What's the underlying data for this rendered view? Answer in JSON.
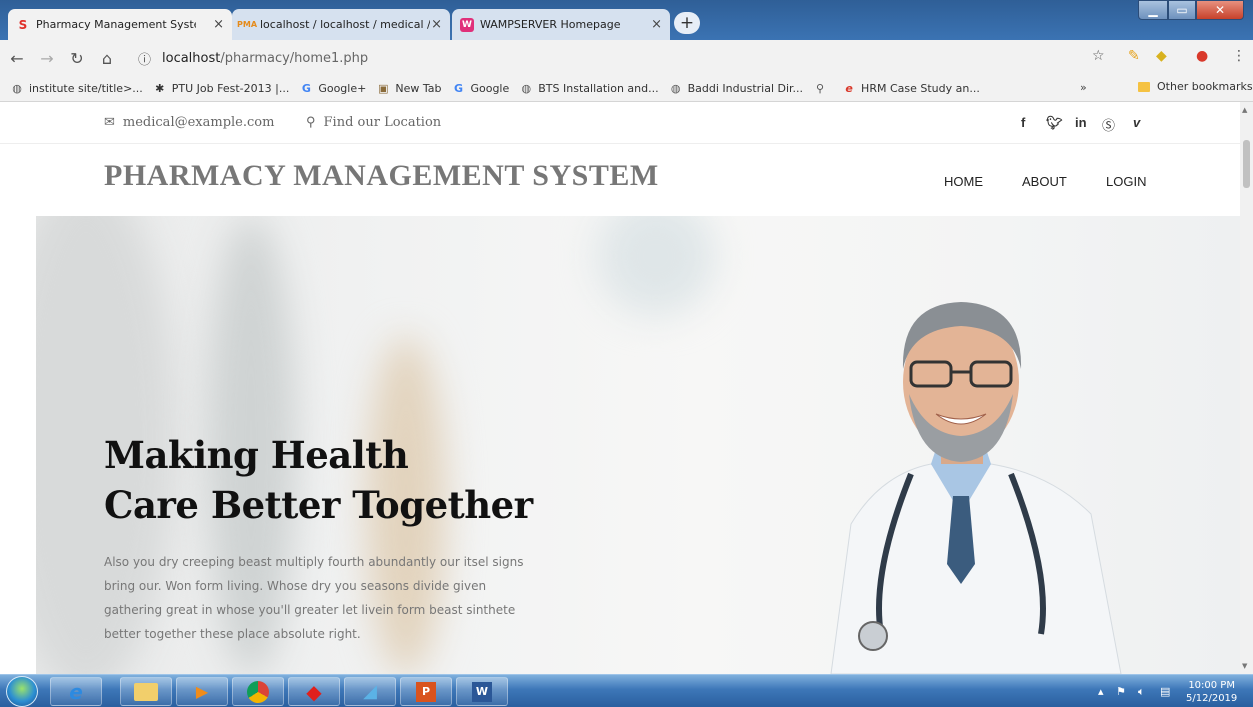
{
  "browser": {
    "tabs": [
      {
        "title": "Pharmacy Management System",
        "favicon": "S",
        "active": true
      },
      {
        "title": "localhost / localhost / medical / t",
        "favicon": "PMA",
        "active": false
      },
      {
        "title": "WAMPSERVER Homepage",
        "favicon": "W",
        "active": false
      }
    ],
    "close_glyph": "×",
    "new_tab_glyph": "+",
    "address": {
      "host": "localhost",
      "path": "/pharmacy/home1.php"
    },
    "bookmarks": [
      {
        "label": "institute site/title>...",
        "icon": "globe-icon"
      },
      {
        "label": "PTU Job Fest-2013 |...",
        "icon": "ptu-icon"
      },
      {
        "label": "Google+",
        "icon": "google-icon"
      },
      {
        "label": "New Tab",
        "icon": "newtab-icon"
      },
      {
        "label": "Google",
        "icon": "google-icon"
      },
      {
        "label": "BTS Installation and...",
        "icon": "globe-icon"
      },
      {
        "label": "Baddi Industrial Dir...",
        "icon": "globe-icon"
      },
      {
        "label": "HRM Case Study an...",
        "icon": "ie-icon"
      }
    ],
    "bookmarks_more": "»",
    "other_bookmarks": "Other bookmarks"
  },
  "site": {
    "email": "medical@example.com",
    "location": "Find our Location",
    "social": [
      "f",
      "t",
      "in",
      "s",
      "v"
    ],
    "brand": "PHARMACY MANAGEMENT SYSTEM",
    "nav": [
      "HOME",
      "ABOUT",
      "LOGIN"
    ],
    "hero": {
      "title_line1": "Making Health",
      "title_line2": "Care Better Together",
      "text": "Also you dry creeping beast multiply fourth abundantly our itsel signs bring our. Won form living. Whose dry you seasons divide given gathering great in whose you'll greater let livein form beast sinthete better together these place absolute right."
    }
  },
  "taskbar": {
    "time": "10:00 PM",
    "date": "5/12/2019",
    "apps": [
      "ie-icon",
      "explorer-icon",
      "media-player-icon",
      "chrome-icon",
      "app-red-icon",
      "app-blue-icon",
      "powerpoint-icon",
      "word-icon"
    ]
  }
}
